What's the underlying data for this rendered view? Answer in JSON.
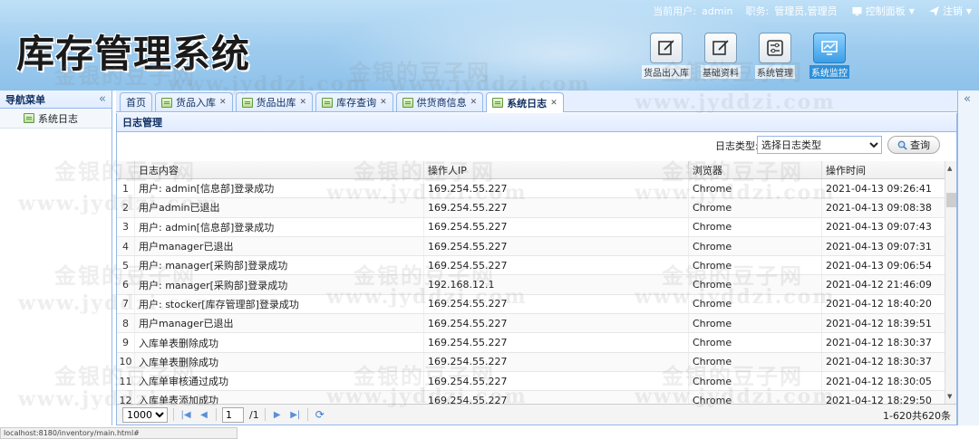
{
  "app": {
    "title": "库存管理系统"
  },
  "userbar": {
    "user_label": "当前用户:",
    "user_value": "admin",
    "role_label": "职务:",
    "role_value": "管理员,管理员",
    "control_panel": "控制面板",
    "logout": "注销"
  },
  "tiles": [
    {
      "label": "货品出入库"
    },
    {
      "label": "基础资料"
    },
    {
      "label": "系统管理"
    },
    {
      "label": "系统监控"
    }
  ],
  "nav": {
    "header": "导航菜单",
    "items": [
      "系统日志"
    ]
  },
  "tabs": [
    "首页",
    "货品入库",
    "货品出库",
    "库存查询",
    "供货商信息",
    "系统日志"
  ],
  "panel": {
    "title": "日志管理"
  },
  "filter": {
    "label": "日志类型:",
    "selected": "选择日志类型",
    "query_button": "查询"
  },
  "grid": {
    "columns": [
      "日志内容",
      "操作人IP",
      "浏览器",
      "操作时间"
    ],
    "rows": [
      {
        "n": "1",
        "content": "用户: admin[信息部]登录成功",
        "ip": "169.254.55.227",
        "browser": "Chrome",
        "time": "2021-04-13 09:26:41"
      },
      {
        "n": "2",
        "content": "用户admin已退出",
        "ip": "169.254.55.227",
        "browser": "Chrome",
        "time": "2021-04-13 09:08:38"
      },
      {
        "n": "3",
        "content": "用户: admin[信息部]登录成功",
        "ip": "169.254.55.227",
        "browser": "Chrome",
        "time": "2021-04-13 09:07:43"
      },
      {
        "n": "4",
        "content": "用户manager已退出",
        "ip": "169.254.55.227",
        "browser": "Chrome",
        "time": "2021-04-13 09:07:31"
      },
      {
        "n": "5",
        "content": "用户: manager[采购部]登录成功",
        "ip": "169.254.55.227",
        "browser": "Chrome",
        "time": "2021-04-13 09:06:54"
      },
      {
        "n": "6",
        "content": "用户: manager[采购部]登录成功",
        "ip": "192.168.12.1",
        "browser": "Chrome",
        "time": "2021-04-12 21:46:09"
      },
      {
        "n": "7",
        "content": "用户: stocker[库存管理部]登录成功",
        "ip": "169.254.55.227",
        "browser": "Chrome",
        "time": "2021-04-12 18:40:20"
      },
      {
        "n": "8",
        "content": "用户manager已退出",
        "ip": "169.254.55.227",
        "browser": "Chrome",
        "time": "2021-04-12 18:39:51"
      },
      {
        "n": "9",
        "content": "入库单表删除成功",
        "ip": "169.254.55.227",
        "browser": "Chrome",
        "time": "2021-04-12 18:30:37"
      },
      {
        "n": "10",
        "content": "入库单表删除成功",
        "ip": "169.254.55.227",
        "browser": "Chrome",
        "time": "2021-04-12 18:30:37"
      },
      {
        "n": "11",
        "content": "入库单审核通过成功",
        "ip": "169.254.55.227",
        "browser": "Chrome",
        "time": "2021-04-12 18:30:05"
      },
      {
        "n": "12",
        "content": "入库单表添加成功",
        "ip": "169.254.55.227",
        "browser": "Chrome",
        "time": "2021-04-12 18:29:50"
      }
    ]
  },
  "pager": {
    "page_size": "1000",
    "page": "1",
    "total_pages": "/1",
    "info": "1-620共620条"
  },
  "statusbar": "localhost:8180/inventory/main.html#",
  "watermark": {
    "cn": "金银的豆子网",
    "en": "www.jyddzi.com"
  },
  "colors": {
    "accent": "#95b8e7",
    "header_bg": "#9dcbee",
    "tile_active": "#2f8fd8"
  }
}
